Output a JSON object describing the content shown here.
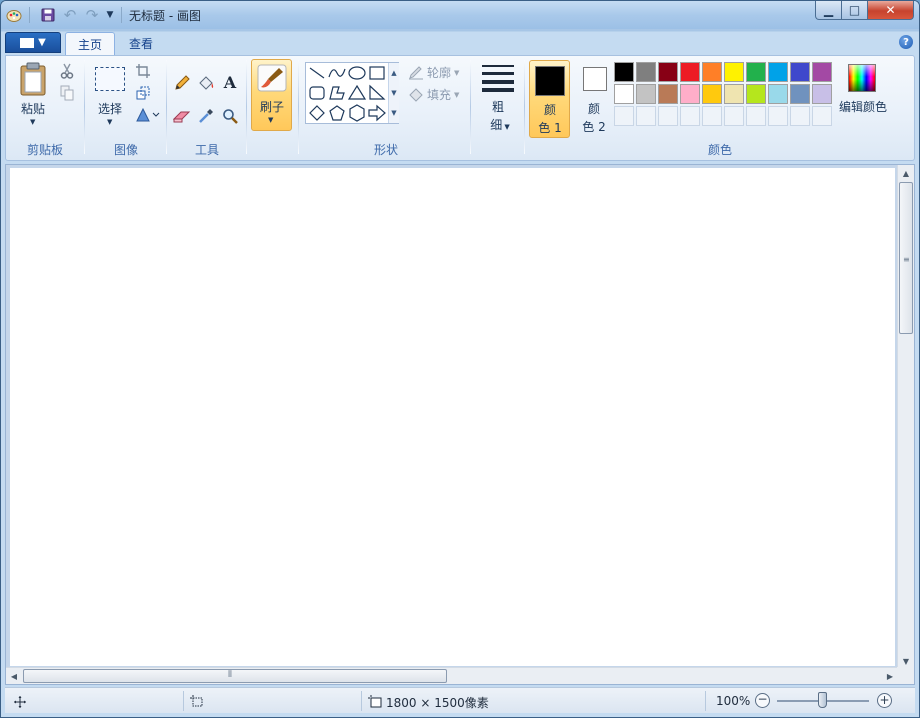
{
  "window": {
    "title": "无标题 - 画图",
    "controls": {
      "minimize": "▁",
      "maximize": "□",
      "close": "✕"
    }
  },
  "quick_access": {
    "items": [
      "app-icon",
      "save-icon",
      "undo-icon",
      "redo-icon",
      "customize-dropdown-icon"
    ]
  },
  "tabs": [
    {
      "label": "主页",
      "active": true
    },
    {
      "label": "查看",
      "active": false
    }
  ],
  "help": "?",
  "ribbon": {
    "clipboard": {
      "label": "剪贴板",
      "paste": "粘贴"
    },
    "image": {
      "label": "图像",
      "select": "选择"
    },
    "tools": {
      "label": "工具",
      "text_glyph": "A"
    },
    "brushes": {
      "label": "刷子"
    },
    "shapes": {
      "label": "形状",
      "outline": "轮廓",
      "fill": "填充"
    },
    "size": {
      "label_1": "粗",
      "label_2": "细"
    },
    "colors": {
      "label": "颜色",
      "color1_a": "颜",
      "color1_b": "色 1",
      "color2_a": "颜",
      "color2_b": "色 2",
      "edit": "编辑颜色",
      "color1_value": "#000000",
      "color2_value": "#ffffff",
      "palette_row1": [
        "#000000",
        "#7f7f7f",
        "#880015",
        "#ed1c24",
        "#ff7f27",
        "#fff200",
        "#22b14c",
        "#00a2e8",
        "#3f48cc",
        "#a349a4"
      ],
      "palette_row2": [
        "#ffffff",
        "#c3c3c3",
        "#b97a57",
        "#ffaec9",
        "#ffc90e",
        "#efe4b0",
        "#b5e61d",
        "#99d9ea",
        "#7092be",
        "#c8bfe7"
      ],
      "palette_row3_empty": 10
    }
  },
  "statusbar": {
    "canvas_size": "1800 × 1500像素",
    "zoom": "100%",
    "zoom_out": "−",
    "zoom_in": "+"
  }
}
